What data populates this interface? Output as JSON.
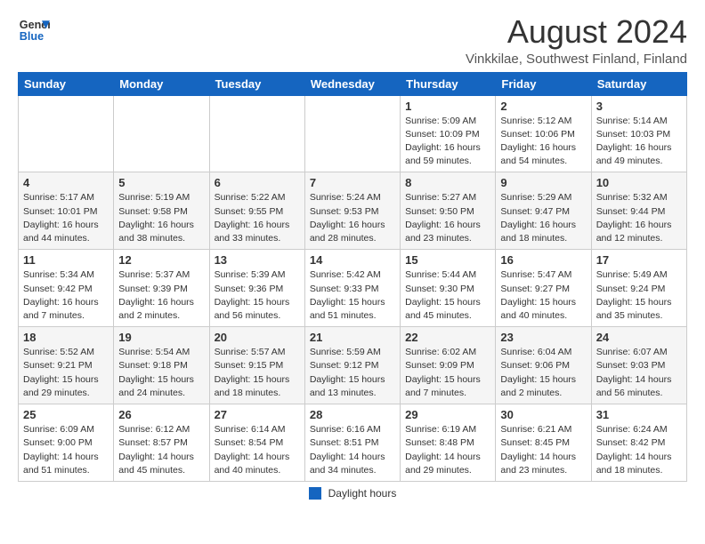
{
  "header": {
    "logo_line1": "General",
    "logo_line2": "Blue",
    "month_year": "August 2024",
    "location": "Vinkkilae, Southwest Finland, Finland"
  },
  "weekdays": [
    "Sunday",
    "Monday",
    "Tuesday",
    "Wednesday",
    "Thursday",
    "Friday",
    "Saturday"
  ],
  "weeks": [
    [
      {
        "day": "",
        "info": ""
      },
      {
        "day": "",
        "info": ""
      },
      {
        "day": "",
        "info": ""
      },
      {
        "day": "",
        "info": ""
      },
      {
        "day": "1",
        "info": "Sunrise: 5:09 AM\nSunset: 10:09 PM\nDaylight: 16 hours\nand 59 minutes."
      },
      {
        "day": "2",
        "info": "Sunrise: 5:12 AM\nSunset: 10:06 PM\nDaylight: 16 hours\nand 54 minutes."
      },
      {
        "day": "3",
        "info": "Sunrise: 5:14 AM\nSunset: 10:03 PM\nDaylight: 16 hours\nand 49 minutes."
      }
    ],
    [
      {
        "day": "4",
        "info": "Sunrise: 5:17 AM\nSunset: 10:01 PM\nDaylight: 16 hours\nand 44 minutes."
      },
      {
        "day": "5",
        "info": "Sunrise: 5:19 AM\nSunset: 9:58 PM\nDaylight: 16 hours\nand 38 minutes."
      },
      {
        "day": "6",
        "info": "Sunrise: 5:22 AM\nSunset: 9:55 PM\nDaylight: 16 hours\nand 33 minutes."
      },
      {
        "day": "7",
        "info": "Sunrise: 5:24 AM\nSunset: 9:53 PM\nDaylight: 16 hours\nand 28 minutes."
      },
      {
        "day": "8",
        "info": "Sunrise: 5:27 AM\nSunset: 9:50 PM\nDaylight: 16 hours\nand 23 minutes."
      },
      {
        "day": "9",
        "info": "Sunrise: 5:29 AM\nSunset: 9:47 PM\nDaylight: 16 hours\nand 18 minutes."
      },
      {
        "day": "10",
        "info": "Sunrise: 5:32 AM\nSunset: 9:44 PM\nDaylight: 16 hours\nand 12 minutes."
      }
    ],
    [
      {
        "day": "11",
        "info": "Sunrise: 5:34 AM\nSunset: 9:42 PM\nDaylight: 16 hours\nand 7 minutes."
      },
      {
        "day": "12",
        "info": "Sunrise: 5:37 AM\nSunset: 9:39 PM\nDaylight: 16 hours\nand 2 minutes."
      },
      {
        "day": "13",
        "info": "Sunrise: 5:39 AM\nSunset: 9:36 PM\nDaylight: 15 hours\nand 56 minutes."
      },
      {
        "day": "14",
        "info": "Sunrise: 5:42 AM\nSunset: 9:33 PM\nDaylight: 15 hours\nand 51 minutes."
      },
      {
        "day": "15",
        "info": "Sunrise: 5:44 AM\nSunset: 9:30 PM\nDaylight: 15 hours\nand 45 minutes."
      },
      {
        "day": "16",
        "info": "Sunrise: 5:47 AM\nSunset: 9:27 PM\nDaylight: 15 hours\nand 40 minutes."
      },
      {
        "day": "17",
        "info": "Sunrise: 5:49 AM\nSunset: 9:24 PM\nDaylight: 15 hours\nand 35 minutes."
      }
    ],
    [
      {
        "day": "18",
        "info": "Sunrise: 5:52 AM\nSunset: 9:21 PM\nDaylight: 15 hours\nand 29 minutes."
      },
      {
        "day": "19",
        "info": "Sunrise: 5:54 AM\nSunset: 9:18 PM\nDaylight: 15 hours\nand 24 minutes."
      },
      {
        "day": "20",
        "info": "Sunrise: 5:57 AM\nSunset: 9:15 PM\nDaylight: 15 hours\nand 18 minutes."
      },
      {
        "day": "21",
        "info": "Sunrise: 5:59 AM\nSunset: 9:12 PM\nDaylight: 15 hours\nand 13 minutes."
      },
      {
        "day": "22",
        "info": "Sunrise: 6:02 AM\nSunset: 9:09 PM\nDaylight: 15 hours\nand 7 minutes."
      },
      {
        "day": "23",
        "info": "Sunrise: 6:04 AM\nSunset: 9:06 PM\nDaylight: 15 hours\nand 2 minutes."
      },
      {
        "day": "24",
        "info": "Sunrise: 6:07 AM\nSunset: 9:03 PM\nDaylight: 14 hours\nand 56 minutes."
      }
    ],
    [
      {
        "day": "25",
        "info": "Sunrise: 6:09 AM\nSunset: 9:00 PM\nDaylight: 14 hours\nand 51 minutes."
      },
      {
        "day": "26",
        "info": "Sunrise: 6:12 AM\nSunset: 8:57 PM\nDaylight: 14 hours\nand 45 minutes."
      },
      {
        "day": "27",
        "info": "Sunrise: 6:14 AM\nSunset: 8:54 PM\nDaylight: 14 hours\nand 40 minutes."
      },
      {
        "day": "28",
        "info": "Sunrise: 6:16 AM\nSunset: 8:51 PM\nDaylight: 14 hours\nand 34 minutes."
      },
      {
        "day": "29",
        "info": "Sunrise: 6:19 AM\nSunset: 8:48 PM\nDaylight: 14 hours\nand 29 minutes."
      },
      {
        "day": "30",
        "info": "Sunrise: 6:21 AM\nSunset: 8:45 PM\nDaylight: 14 hours\nand 23 minutes."
      },
      {
        "day": "31",
        "info": "Sunrise: 6:24 AM\nSunset: 8:42 PM\nDaylight: 14 hours\nand 18 minutes."
      }
    ]
  ],
  "footer": {
    "legend_label": "Daylight hours"
  }
}
